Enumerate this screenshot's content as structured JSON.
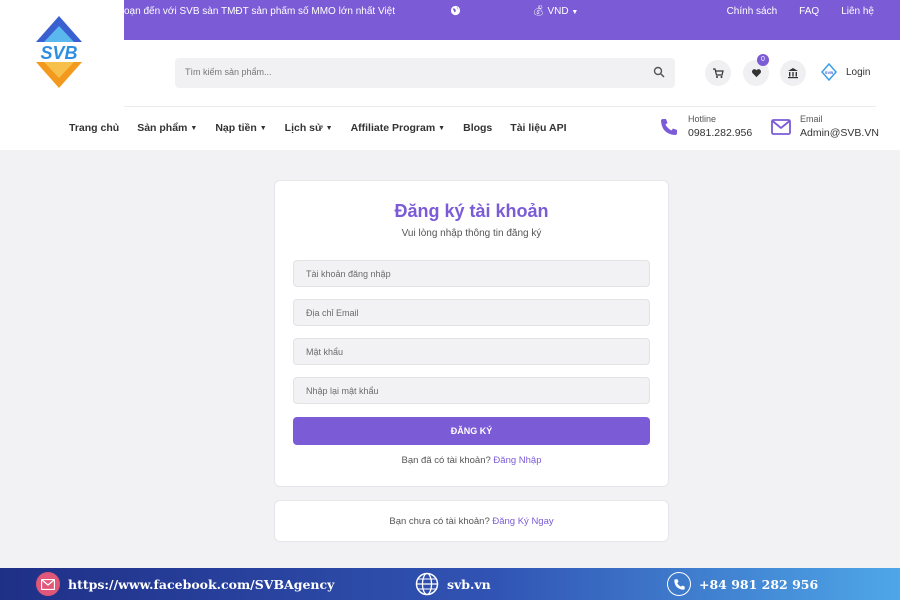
{
  "topbar": {
    "marquee": "oạn đến với SVB sàn TMĐT sản phẩm số MMO lớn nhất Việt",
    "currency": "VND",
    "links": [
      "Chính sách",
      "FAQ",
      "Liên hệ"
    ]
  },
  "logo": {
    "text": "SVB"
  },
  "header": {
    "search_placeholder": "Tìm kiếm sản phẩm...",
    "wishlist_count": "0",
    "login_label": "Login"
  },
  "nav": {
    "items": [
      {
        "label": "Trang chủ",
        "dropdown": false
      },
      {
        "label": "Sản phẩm",
        "dropdown": true
      },
      {
        "label": "Nạp tiền",
        "dropdown": true
      },
      {
        "label": "Lịch sử",
        "dropdown": true
      },
      {
        "label": "Affiliate Program",
        "dropdown": true
      },
      {
        "label": "Blogs",
        "dropdown": false
      },
      {
        "label": "Tài liệu API",
        "dropdown": false
      }
    ]
  },
  "contact": {
    "hotline_label": "Hotline",
    "hotline_value": "0981.282.956",
    "email_label": "Email",
    "email_value": "Admin@SVB.VN"
  },
  "form": {
    "title": "Đăng ký tài khoản",
    "subtitle": "Vui lòng nhập thông tin đăng ký",
    "username_placeholder": "Tài khoản đăng nhập",
    "email_placeholder": "Địa chỉ Email",
    "password_placeholder": "Mật khẩu",
    "confirm_placeholder": "Nhập lại mật khẩu",
    "submit_label": "ĐĂNG KÝ",
    "login_prompt": "Bạn đã có tài khoản?",
    "login_link": "Đăng Nhập"
  },
  "signup_card": {
    "prompt": "Bạn chưa có tài khoản?",
    "link": "Đăng Ký Ngay"
  },
  "footer": {
    "facebook": "https://www.facebook.com/SVBAgency",
    "website": "svb.vn",
    "phone": "+84 981 282 956"
  },
  "colors": {
    "accent": "#7b5bd6"
  }
}
